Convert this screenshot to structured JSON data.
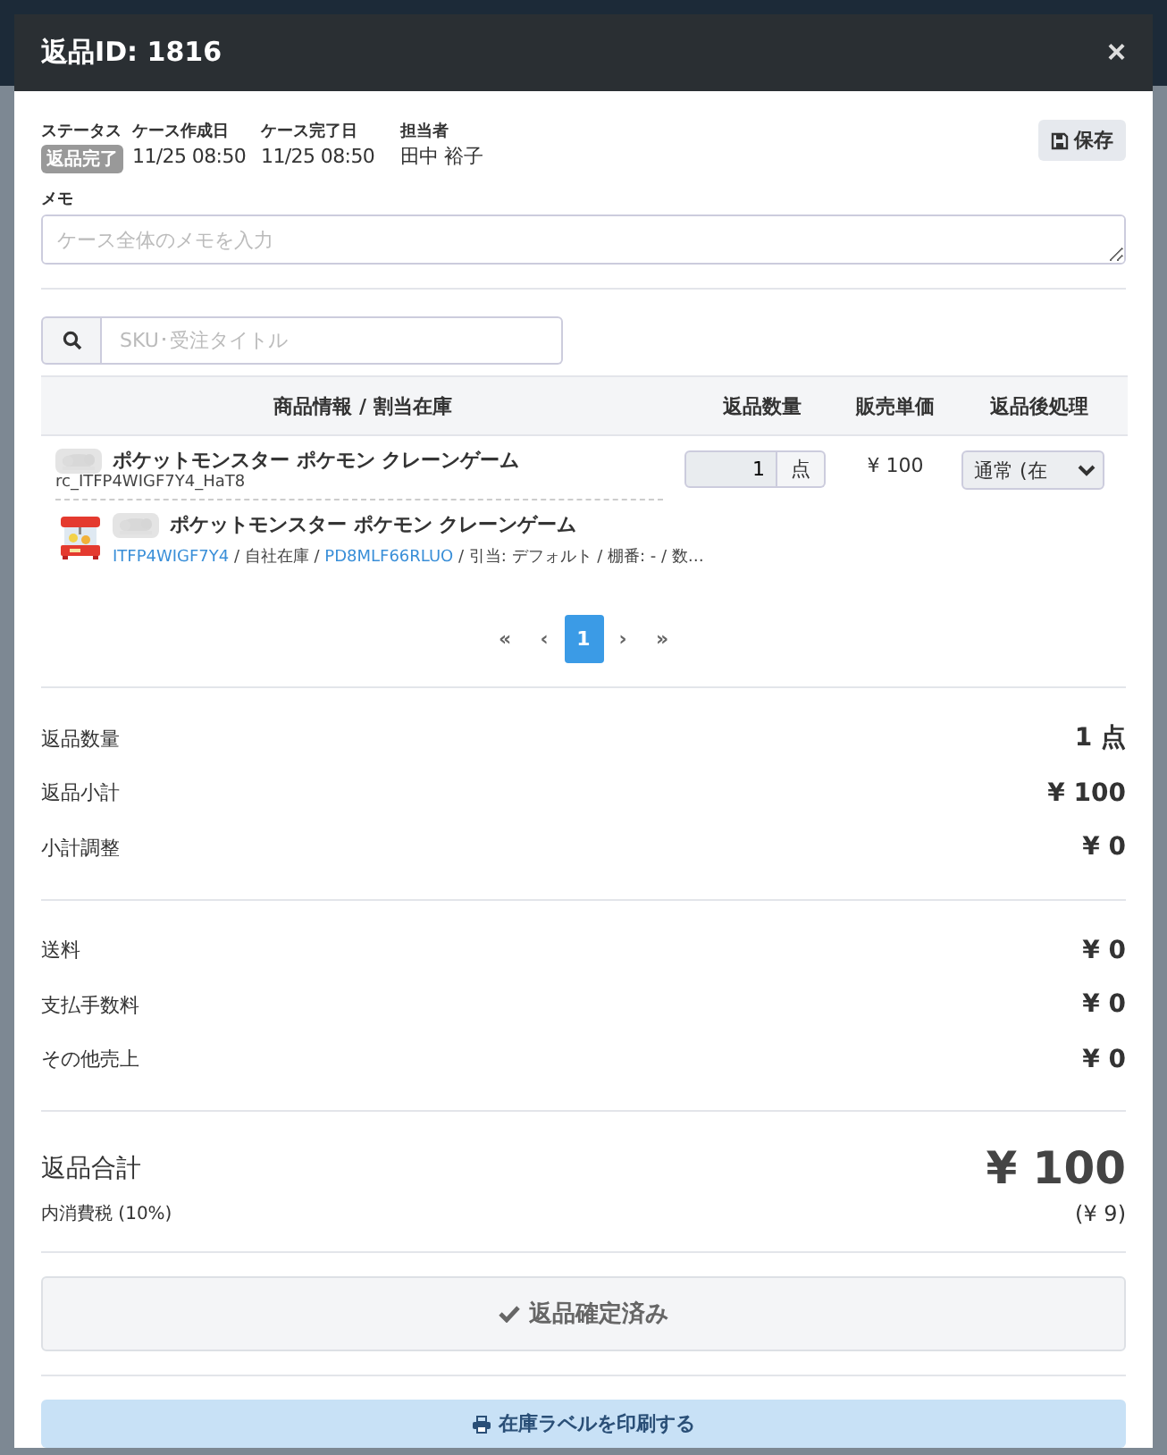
{
  "modal": {
    "title": "返品ID: 1816",
    "close": "×"
  },
  "info": [
    {
      "label": "ステータス",
      "value": "返品完了",
      "kind": "badge"
    },
    {
      "label": "ケース作成日",
      "value": "11/25 08:50",
      "kind": "text"
    },
    {
      "label": "ケース完了日",
      "value": "11/25 08:50",
      "kind": "text"
    },
    {
      "label": "担当者",
      "value": "田中 裕子",
      "kind": "person"
    }
  ],
  "save_button": "保存",
  "memo": {
    "label": "メモ",
    "placeholder": "ケース全体のメモを入力"
  },
  "search": {
    "placeholder": "SKU･受注タイトル"
  },
  "table": {
    "columns": [
      "商品情報 / 割当在庫",
      "返品数量",
      "販売単価",
      "返品後処理"
    ],
    "rows": [
      {
        "name": "ポケットモンスター ポケモン クレーンゲーム",
        "sku": "rc_ITFP4WIGF7Y4_HaT8",
        "stock_name": "ポケットモンスター ポケモン クレーンゲーム",
        "stock_links": [
          "ITFP4WIGF7Y4",
          "PD8MLF66RLUO"
        ],
        "stock_parts": [
          " / 自社在庫 / ",
          " / 引当: デフォルト / 棚番: - / 数…"
        ],
        "qty": "1",
        "unit": "点",
        "price": "¥ 100",
        "action": "通常 (在"
      }
    ]
  },
  "pagination": [
    {
      "label": "«",
      "selected": false
    },
    {
      "label": "‹",
      "selected": false
    },
    {
      "label": "1",
      "selected": true
    },
    {
      "label": "›",
      "selected": false
    },
    {
      "label": "»",
      "selected": false
    }
  ],
  "summary_groups": [
    [
      {
        "label": "返品数量",
        "value": "1 点"
      },
      {
        "label": "返品小計",
        "value": "¥ 100"
      },
      {
        "label": "小計調整",
        "value": "¥ 0"
      }
    ],
    [
      {
        "label": "送料",
        "value": "¥ 0"
      },
      {
        "label": "支払手数料",
        "value": "¥ 0"
      },
      {
        "label": "その他売上",
        "value": "¥ 0"
      }
    ]
  ],
  "total": {
    "label": "返品合計",
    "value": "¥ 100",
    "tax_label": "内消費税 (10%)",
    "tax_value": "(¥ 9)"
  },
  "confirm_button": {
    "label": "返品確定済み",
    "disabled": true
  },
  "print_button": "在庫ラベルを印刷する"
}
